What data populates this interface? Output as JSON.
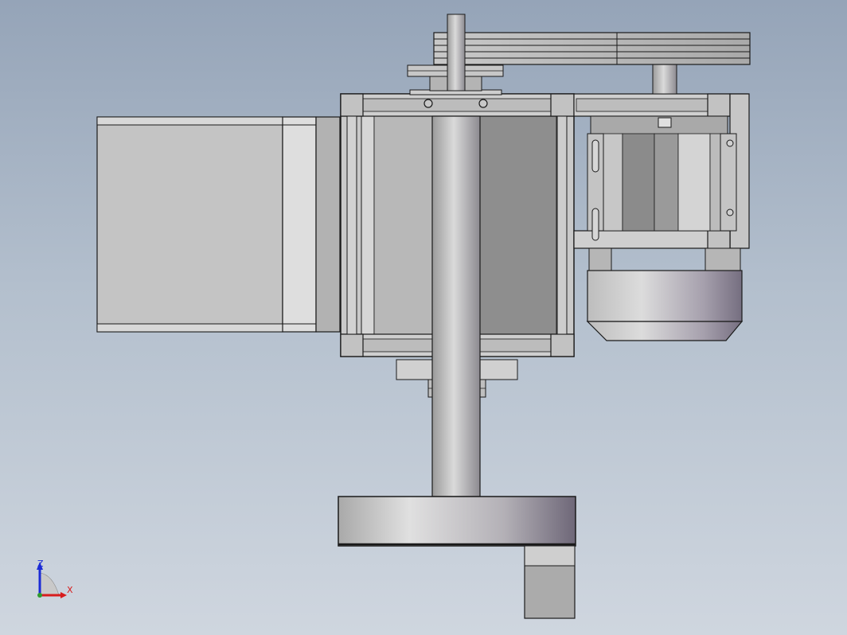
{
  "view": {
    "type": "CAD front view",
    "background": [
      "#95a4b8",
      "#cfd6df"
    ]
  },
  "colors": {
    "part_light": "#d4d4d4",
    "part_mid": "#b9b9b9",
    "part_dark": "#8e8e8e",
    "edge": "#1a1a1a",
    "cylinder_highlight": "#e2e2e2",
    "cylinder_shadow": "#6d6677"
  },
  "triad": {
    "z_label": "Z",
    "x_label": "X",
    "z_color": "#1b2bd6",
    "x_color": "#d81c1c",
    "y_color": "#2f9a2f"
  }
}
